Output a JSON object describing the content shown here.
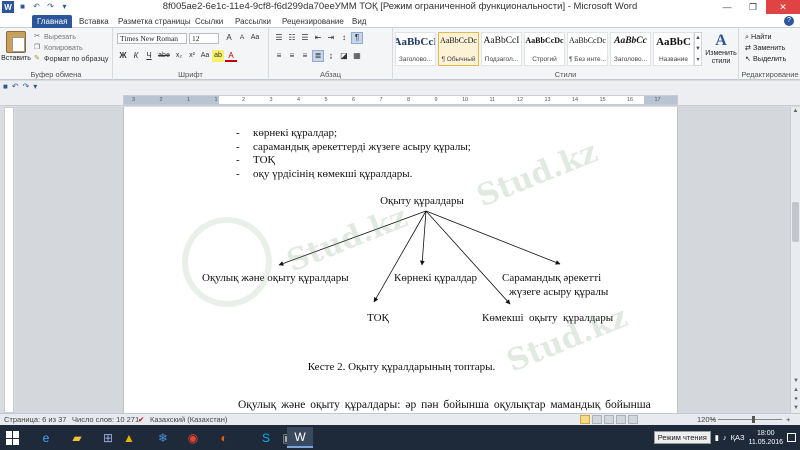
{
  "window": {
    "title": "8f005ae2-6e1c-11e4-9cf8-f6d299da70eeУММ ТОҚ [Режим ограниченной функциональности] - Microsoft Word",
    "app_logo": "W"
  },
  "tabs": [
    "Главная",
    "Вставка",
    "Разметка страницы",
    "Ссылки",
    "Рассылки",
    "Рецензирование",
    "Вид"
  ],
  "ribbon": {
    "clipboard": {
      "paste_label": "Вставить",
      "cut_label": "Вырезать",
      "copy_label": "Копировать",
      "format_painter_label": "Формат по образцу",
      "group_label": "Буфер обмена"
    },
    "font": {
      "font_name": "Times New Roman",
      "font_size": "12",
      "bold": "Ж",
      "italic": "К",
      "underline": "Ч",
      "strike": "abe",
      "subscript": "x₂",
      "superscript": "x²",
      "clear": "Aa",
      "grow": "A",
      "shrink": "A",
      "font_color": "A",
      "highlight": "ab",
      "group_label": "Шрифт"
    },
    "paragraph": {
      "group_label": "Абзац",
      "show_marks": "¶"
    },
    "styles": {
      "group_label": "Стили",
      "items": [
        {
          "sample": "AaBbCcI",
          "name": "Заголово..."
        },
        {
          "sample": "AaBbCcDc",
          "name": "¶ Обычный"
        },
        {
          "sample": "AaBbCcI",
          "name": "Подзагол..."
        },
        {
          "sample": "AaBbCcDc",
          "name": "Строгий"
        },
        {
          "sample": "AaBbCcDc",
          "name": "¶ Без инте..."
        },
        {
          "sample": "AaBbCc",
          "name": "Заголово..."
        },
        {
          "sample": "AaBbC",
          "name": "Название"
        }
      ],
      "change_styles_label": "Изменить стили"
    },
    "editing": {
      "group_label": "Редактирование",
      "find_label": "Найти",
      "replace_label": "Заменить",
      "select_label": "Выделить"
    }
  },
  "document": {
    "bullets": [
      "көрнекі құралдар;",
      "сарамандық әрекеттерді жүзеге асыру құралы;",
      "ТОҚ",
      "оқу үрдісінің көмекші құралдары."
    ],
    "bullet_marker": "-",
    "diagram": {
      "root": "Оқыту құралдары",
      "nodes": [
        "Оқулық және оқыту құралдары",
        "Көрнекі құралдар",
        "Сарамандық әрекетті",
        "жүзеге асыру құралы",
        "ТОҚ",
        "Көмекші  оқыту  құралдары"
      ]
    },
    "caption": "Кесте 2. Оқыту құралдарының топтары.",
    "paragraph_start": "Оқулық  және  оқыту  құралдары:  әр  пән  бойынша  оқулықтар  мамандық  бойынша"
  },
  "ruler": {
    "ticks": [
      "3",
      "2",
      "1",
      "1",
      "2",
      "3",
      "4",
      "5",
      "6",
      "7",
      "8",
      "9",
      "10",
      "11",
      "12",
      "13",
      "14",
      "15",
      "16",
      "17"
    ]
  },
  "statusbar": {
    "page": "Страница: 6 из 37",
    "words": "Число слов: 10 271",
    "language": "Казахский (Казахстан)",
    "zoom": "120%"
  },
  "taskbar": {
    "tooltip": "Режим чтения",
    "lang": "ҚАЗ",
    "time": "18:00",
    "date": "11.05.2016"
  },
  "watermark": "Stud.kz"
}
